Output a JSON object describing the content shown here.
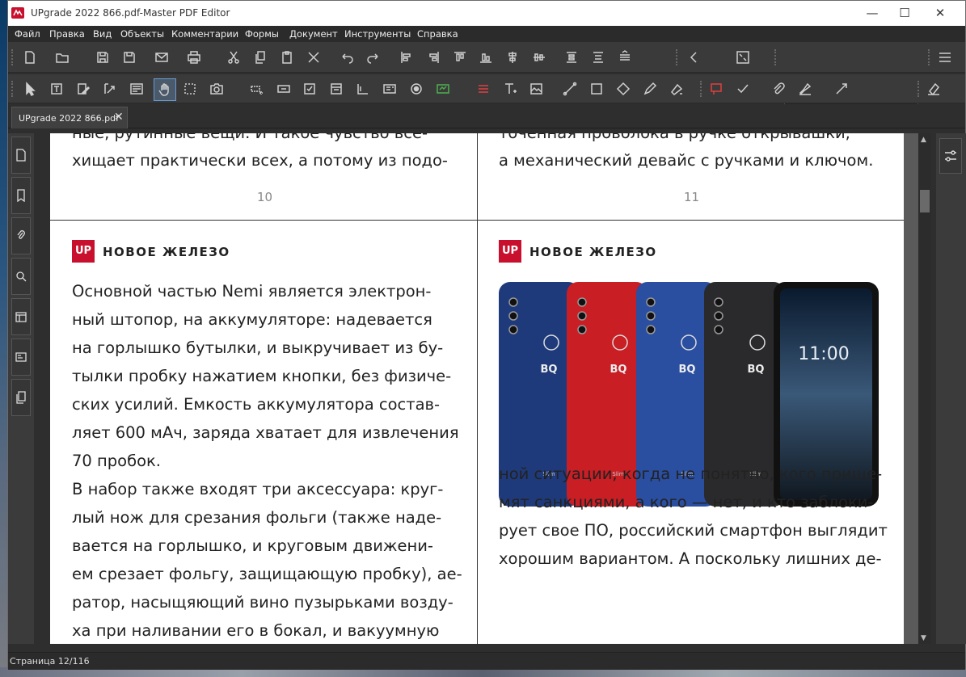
{
  "window": {
    "title": "UPgrade 2022 866.pdf-Master PDF Editor",
    "minimize": "—",
    "maximize": "☐",
    "close": "✕"
  },
  "menu": [
    "Файл",
    "Правка",
    "Вид",
    "Объекты",
    "Комментарии",
    "Формы",
    "Документ",
    "Инструменты",
    "Справка"
  ],
  "tab": {
    "label": "UPgrade 2022 866.pdf",
    "close": "✕"
  },
  "search": {
    "placeholder": ""
  },
  "pages": {
    "p10": {
      "lines": [
        "ные, рутинные вещи. И такое чувство все-",
        "хищает практически всех, а потому из подо-"
      ],
      "number": "10"
    },
    "p11": {
      "lines": [
        "точенная проволока в ручке открывашки,",
        "а механический девайс с ручками и ключом."
      ],
      "number": "11"
    },
    "p12": {
      "logo": "UP",
      "section": "НОВОЕ ЖЕЛЕЗО",
      "lines": [
        "Основной частью Nemi является электрон-",
        "ный штопор, на аккумуляторе: надевается",
        "на горлышко бутылки, и выкручивает из бу-",
        "тылки пробку нажатием кнопки, без физиче-",
        "ских усилий. Емкость аккумулятора состав-",
        "ляет 600 мАч, заряда хватает для извлечения",
        "70 пробок.",
        "В набор также входят три аксессуара: круг-",
        "лый нож для срезания фольги (также наде-",
        "вается на горлышко, и круговым движени-",
        "ем срезает фольгу, защищающую пробку), ае-",
        "ратор, насыщяющий вино пузырьками возду-",
        "ха при наливании его в бокал, и вакуумную"
      ]
    },
    "p13": {
      "logo": "UP",
      "section": "НОВОЕ ЖЕЛЕЗО",
      "phone_brand": "BQ",
      "phone_model": "Slim",
      "phone_time": "11:00",
      "phone_colors": [
        "#1f3a7a",
        "#c81e24",
        "#2a4ea0",
        "#2a2a2c"
      ],
      "lines": [
        "ной ситуации, когда не понятно, кого прище-",
        "мят санкциями, а кого — нет, и кто заблоки-",
        "рует свое ПО, российский смартфон выглядит",
        "хорошим вариантом. А поскольку лишних де-"
      ]
    }
  },
  "status": {
    "page": "Страница 12/116"
  },
  "colors": {
    "brand_red": "#c8102e",
    "app_bg": "#2e2e2e",
    "toolbar_bg": "#3a3a3a"
  }
}
